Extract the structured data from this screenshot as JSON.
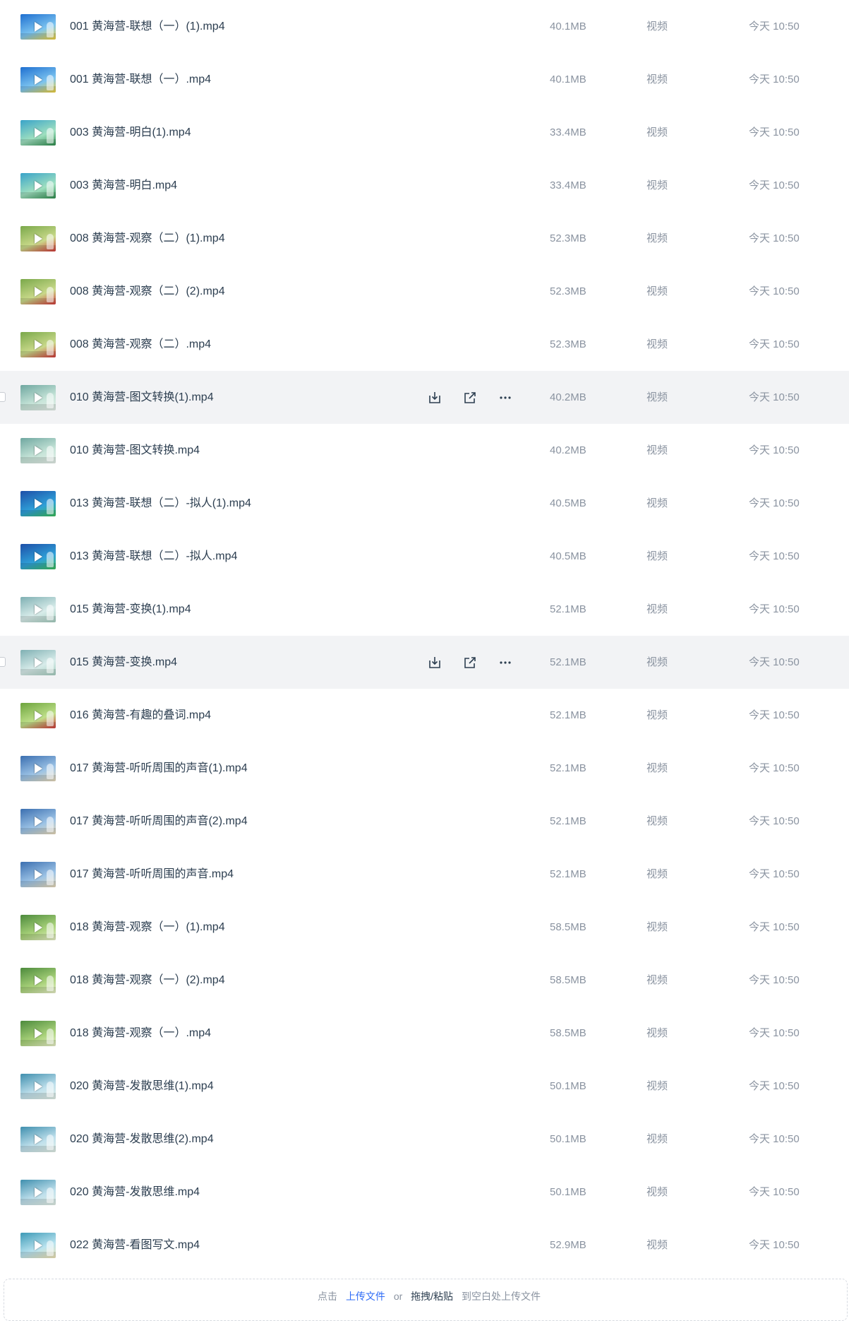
{
  "files": [
    {
      "name": "001 黄海营-联想（一）(1).mp4",
      "size": "40.1MB",
      "type": "视频",
      "time": "今天 10:50",
      "hovered": false,
      "thumb": [
        "#1e6fd0",
        "#7cc4f0",
        "#f3d23a"
      ]
    },
    {
      "name": "001 黄海营-联想（一）.mp4",
      "size": "40.1MB",
      "type": "视频",
      "time": "今天 10:50",
      "hovered": false,
      "thumb": [
        "#1e6fd0",
        "#7cc4f0",
        "#f3d23a"
      ]
    },
    {
      "name": "003 黄海营-明白(1).mp4",
      "size": "33.4MB",
      "type": "视频",
      "time": "今天 10:50",
      "hovered": false,
      "thumb": [
        "#39a3c9",
        "#9fe0c0",
        "#2f8f4e"
      ]
    },
    {
      "name": "003 黄海营-明白.mp4",
      "size": "33.4MB",
      "type": "视频",
      "time": "今天 10:50",
      "hovered": false,
      "thumb": [
        "#39a3c9",
        "#9fe0c0",
        "#2f8f4e"
      ]
    },
    {
      "name": "008 黄海营-观察（二）(1).mp4",
      "size": "52.3MB",
      "type": "视频",
      "time": "今天 10:50",
      "hovered": false,
      "thumb": [
        "#7aa84a",
        "#c9d98a",
        "#d23a3a"
      ]
    },
    {
      "name": "008 黄海营-观察（二）(2).mp4",
      "size": "52.3MB",
      "type": "视频",
      "time": "今天 10:50",
      "hovered": false,
      "thumb": [
        "#7aa84a",
        "#c9d98a",
        "#d23a3a"
      ]
    },
    {
      "name": "008 黄海营-观察（二）.mp4",
      "size": "52.3MB",
      "type": "视频",
      "time": "今天 10:50",
      "hovered": false,
      "thumb": [
        "#7aa84a",
        "#c9d98a",
        "#d23a3a"
      ]
    },
    {
      "name": "010 黄海营-图文转换(1).mp4",
      "size": "40.2MB",
      "type": "视频",
      "time": "今天 10:50",
      "hovered": true,
      "thumb": [
        "#6fa7a0",
        "#c6e4d8",
        "#e6efe9"
      ]
    },
    {
      "name": "010 黄海营-图文转换.mp4",
      "size": "40.2MB",
      "type": "视频",
      "time": "今天 10:50",
      "hovered": false,
      "thumb": [
        "#6fa7a0",
        "#c6e4d8",
        "#e6efe9"
      ]
    },
    {
      "name": "013 黄海营-联想（二）-拟人(1).mp4",
      "size": "40.5MB",
      "type": "视频",
      "time": "今天 10:50",
      "hovered": false,
      "thumb": [
        "#1d4fa8",
        "#2fa0d8",
        "#3bbf5a"
      ]
    },
    {
      "name": "013 黄海营-联想（二）-拟人.mp4",
      "size": "40.5MB",
      "type": "视频",
      "time": "今天 10:50",
      "hovered": false,
      "thumb": [
        "#1d4fa8",
        "#2fa0d8",
        "#3bbf5a"
      ]
    },
    {
      "name": "015 黄海营-变换(1).mp4",
      "size": "52.1MB",
      "type": "视频",
      "time": "今天 10:50",
      "hovered": false,
      "thumb": [
        "#7fb0b3",
        "#d8ecea",
        "#a7cfc1"
      ]
    },
    {
      "name": "015 黄海营-变换.mp4",
      "size": "52.1MB",
      "type": "视频",
      "time": "今天 10:50",
      "hovered": true,
      "thumb": [
        "#7fb0b3",
        "#d8ecea",
        "#a7cfc1"
      ]
    },
    {
      "name": "016 黄海营-有趣的叠词.mp4",
      "size": "52.1MB",
      "type": "视频",
      "time": "今天 10:50",
      "hovered": false,
      "thumb": [
        "#6da43d",
        "#bfe08a",
        "#d23a3a"
      ]
    },
    {
      "name": "017 黄海营-听听周围的声音(1).mp4",
      "size": "52.1MB",
      "type": "视频",
      "time": "今天 10:50",
      "hovered": false,
      "thumb": [
        "#3b6fb0",
        "#9cc3e6",
        "#e9d9b8"
      ]
    },
    {
      "name": "017 黄海营-听听周围的声音(2).mp4",
      "size": "52.1MB",
      "type": "视频",
      "time": "今天 10:50",
      "hovered": false,
      "thumb": [
        "#3b6fb0",
        "#9cc3e6",
        "#e9d9b8"
      ]
    },
    {
      "name": "017 黄海营-听听周围的声音.mp4",
      "size": "52.1MB",
      "type": "视频",
      "time": "今天 10:50",
      "hovered": false,
      "thumb": [
        "#3b6fb0",
        "#9cc3e6",
        "#e9d9b8"
      ]
    },
    {
      "name": "018 黄海营-观察（一）(1).mp4",
      "size": "58.5MB",
      "type": "视频",
      "time": "今天 10:50",
      "hovered": false,
      "thumb": [
        "#4c8a3c",
        "#a9d27a",
        "#e9f0c9"
      ]
    },
    {
      "name": "018 黄海营-观察（一）(2).mp4",
      "size": "58.5MB",
      "type": "视频",
      "time": "今天 10:50",
      "hovered": false,
      "thumb": [
        "#4c8a3c",
        "#a9d27a",
        "#e9f0c9"
      ]
    },
    {
      "name": "018 黄海营-观察（一）.mp4",
      "size": "58.5MB",
      "type": "视频",
      "time": "今天 10:50",
      "hovered": false,
      "thumb": [
        "#4c8a3c",
        "#a9d27a",
        "#e9f0c9"
      ]
    },
    {
      "name": "020 黄海营-发散思维(1).mp4",
      "size": "50.1MB",
      "type": "视频",
      "time": "今天 10:50",
      "hovered": false,
      "thumb": [
        "#3f8fae",
        "#bfe0ec",
        "#e2efe6"
      ]
    },
    {
      "name": "020 黄海营-发散思维(2).mp4",
      "size": "50.1MB",
      "type": "视频",
      "time": "今天 10:50",
      "hovered": false,
      "thumb": [
        "#3f8fae",
        "#bfe0ec",
        "#e2efe6"
      ]
    },
    {
      "name": "020 黄海营-发散思维.mp4",
      "size": "50.1MB",
      "type": "视频",
      "time": "今天 10:50",
      "hovered": false,
      "thumb": [
        "#3f8fae",
        "#bfe0ec",
        "#e2efe6"
      ]
    },
    {
      "name": "022 黄海营-看图写文.mp4",
      "size": "52.9MB",
      "type": "视频",
      "time": "今天 10:50",
      "hovered": false,
      "thumb": [
        "#3d9ab7",
        "#b9e3ef",
        "#f1e4b5"
      ]
    }
  ],
  "row_icons": {
    "download": "download-icon",
    "share": "share-icon",
    "more": "more-icon",
    "thumbnail_overlay": "play-icon"
  },
  "upload_hint": {
    "prefix": "点击",
    "upload_link": "上传文件",
    "or": "or",
    "drag_paste": "拖拽/粘贴",
    "suffix": "到空白处上传文件"
  },
  "colors": {
    "hover_row": "#f2f3f5",
    "file_name": "#2c3e50",
    "meta": "#8a93a0",
    "link": "#2f6cf6"
  }
}
